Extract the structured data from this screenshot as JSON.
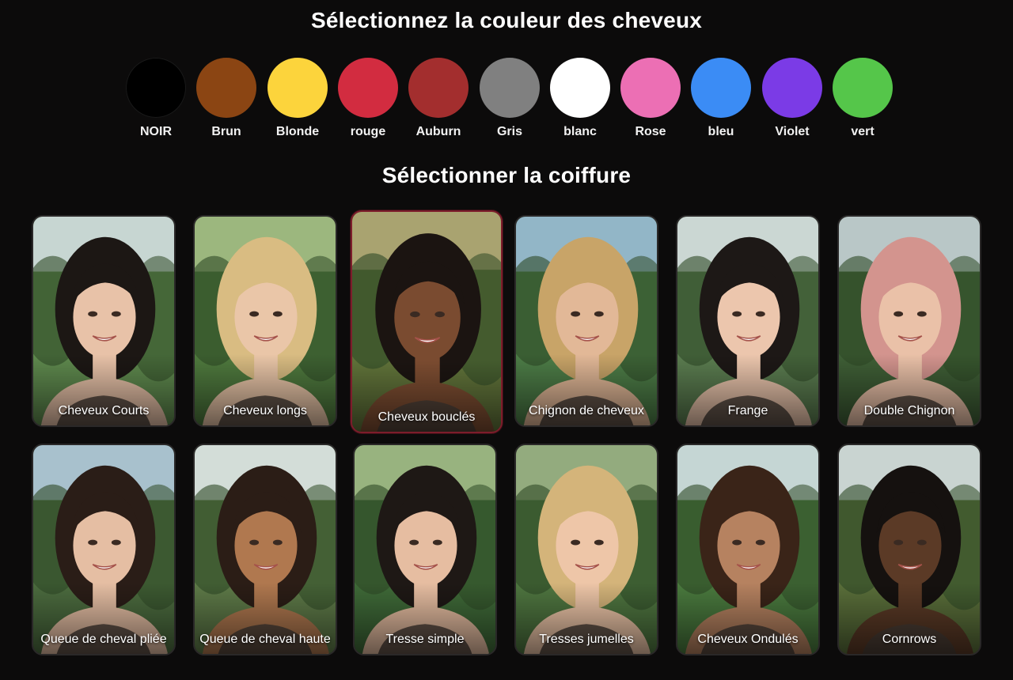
{
  "headings": {
    "hair_color": "Sélectionnez la couleur des cheveux",
    "hairstyle": "Sélectionner la coiffure"
  },
  "colors": [
    {
      "label": "NOIR",
      "hex": "#000000"
    },
    {
      "label": "Brun",
      "hex": "#8b4513"
    },
    {
      "label": "Blonde",
      "hex": "#fcd43c"
    },
    {
      "label": "rouge",
      "hex": "#d22c40"
    },
    {
      "label": "Auburn",
      "hex": "#a32e2e"
    },
    {
      "label": "Gris",
      "hex": "#808080"
    },
    {
      "label": "blanc",
      "hex": "#ffffff"
    },
    {
      "label": "Rose",
      "hex": "#ec6fb4"
    },
    {
      "label": "bleu",
      "hex": "#3b8cf5"
    },
    {
      "label": "Violet",
      "hex": "#7b3be6"
    },
    {
      "label": "vert",
      "hex": "#55c64a"
    }
  ],
  "hairstyles": [
    {
      "label": "Cheveux Courts",
      "selected": false,
      "hair": "#1c1714",
      "skin": "#e8c2a8",
      "bg": "#5f8a4e",
      "sky": "#d9e3ea"
    },
    {
      "label": "Cheveux longs",
      "selected": false,
      "hair": "#d9bc82",
      "skin": "#eac6a8",
      "bg": "#4f7a3e",
      "sky": "#a9c28a"
    },
    {
      "label": "Cheveux bouclés",
      "selected": true,
      "hair": "#1b1411",
      "skin": "#7a4b30",
      "bg": "#5e7038",
      "sky": "#b6ab7a"
    },
    {
      "label": "Chignon de cheveux",
      "selected": false,
      "hair": "#c8a468",
      "skin": "#e2b897",
      "bg": "#4d7d47",
      "sky": "#9fc0de"
    },
    {
      "label": "Frange",
      "selected": false,
      "hair": "#1d1816",
      "skin": "#ecc6ad",
      "bg": "#5b7d50",
      "sky": "#dfe6ea"
    },
    {
      "label": "Double Chignon",
      "selected": false,
      "hair": "#d3948e",
      "skin": "#eac1a8",
      "bg": "#3f5f36",
      "sky": "#cfd9e0"
    },
    {
      "label": "Queue de cheval pliée",
      "selected": false,
      "hair": "#2a1d17",
      "skin": "#e5bea3",
      "bg": "#4c6c3f",
      "sky": "#b8d0e6"
    },
    {
      "label": "Queue de cheval haute",
      "selected": false,
      "hair": "#2b1d16",
      "skin": "#b0784f",
      "bg": "#5e7a48",
      "sky": "#e8eef2"
    },
    {
      "label": "Tresse simple",
      "selected": false,
      "hair": "#1e1815",
      "skin": "#e6bda1",
      "bg": "#3f6a38",
      "sky": "#a8c08c"
    },
    {
      "label": "Tresses jumelles",
      "selected": false,
      "hair": "#d4b47a",
      "skin": "#eec6a8",
      "bg": "#4f7640",
      "sky": "#9fb58a"
    },
    {
      "label": "Cheveux Ondulés",
      "selected": false,
      "hair": "#3a2418",
      "skin": "#b68260",
      "bg": "#4a7a3e",
      "sky": "#dbe6ee"
    },
    {
      "label": "Cornrows",
      "selected": false,
      "hair": "#15110f",
      "skin": "#5b3a26",
      "bg": "#5a6f3a",
      "sky": "#dde6ec"
    }
  ]
}
